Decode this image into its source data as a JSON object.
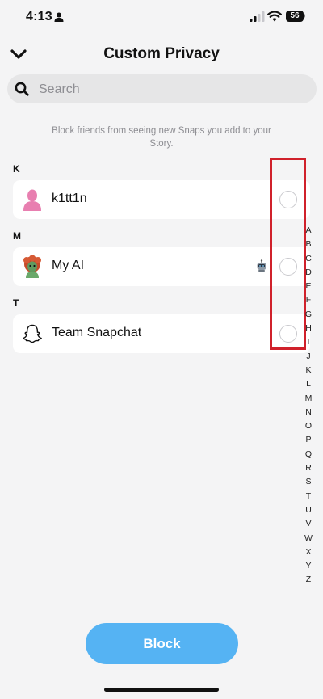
{
  "status_bar": {
    "time": "4:13",
    "battery": "56"
  },
  "header": {
    "title": "Custom Privacy"
  },
  "search": {
    "placeholder": "Search"
  },
  "instructions": "Block friends from seeing new Snaps you add to your Story.",
  "sections": [
    {
      "letter": "K",
      "contacts": [
        {
          "name": "k1tt1n",
          "avatar": "bitmoji-silhouette-icon",
          "selected": false
        }
      ]
    },
    {
      "letter": "M",
      "contacts": [
        {
          "name": "My AI",
          "avatar": "my-ai-avatar",
          "badge": "robot-icon",
          "selected": false
        }
      ]
    },
    {
      "letter": "T",
      "contacts": [
        {
          "name": "Team Snapchat",
          "avatar": "snapchat-ghost-icon",
          "selected": false
        }
      ]
    }
  ],
  "alphabet_index": [
    "A",
    "B",
    "C",
    "D",
    "E",
    "F",
    "G",
    "H",
    "I",
    "J",
    "K",
    "L",
    "M",
    "N",
    "O",
    "P",
    "Q",
    "R",
    "S",
    "T",
    "U",
    "V",
    "W",
    "X",
    "Y",
    "Z"
  ],
  "actions": {
    "block_label": "Block"
  },
  "colors": {
    "accent": "#55b3f3",
    "highlight": "#d0212b",
    "avatar_pink": "#e87fb0"
  }
}
